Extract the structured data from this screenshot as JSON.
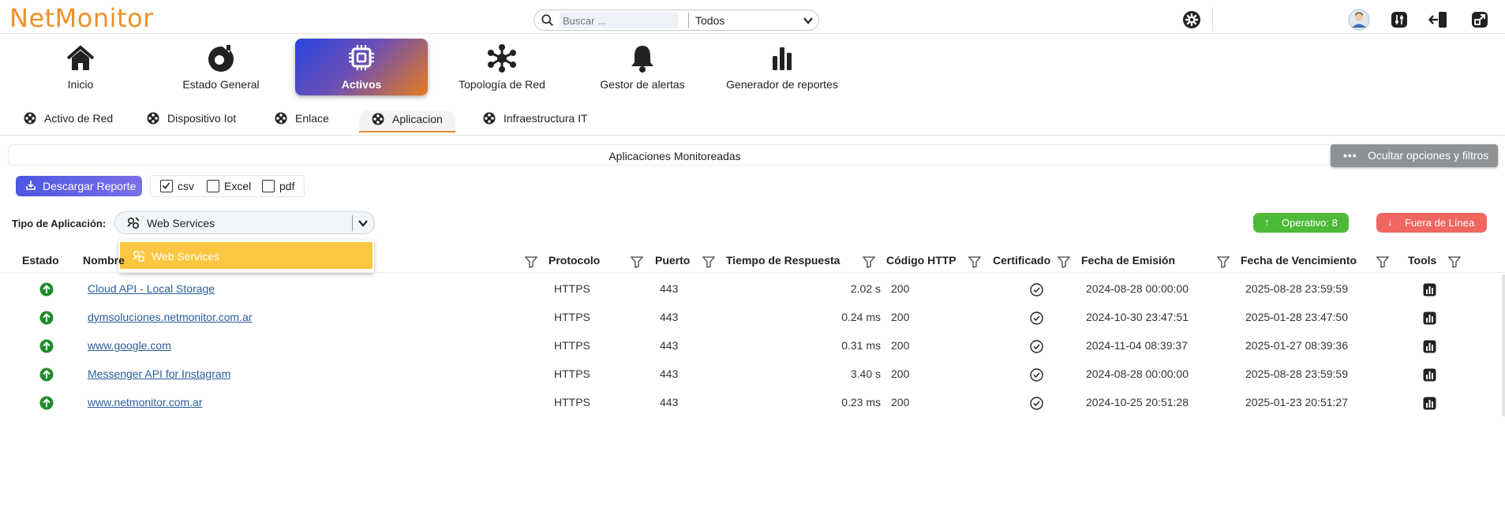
{
  "app": {
    "logo_text": "NetMonitor",
    "brand_color": "#f0902a"
  },
  "search": {
    "placeholder": "Buscar ...",
    "scope_value": "Todos"
  },
  "top_icons": [
    "gear-icon",
    "avatar",
    "sliders-icon",
    "logout-icon",
    "expand-icon"
  ],
  "main_nav": [
    {
      "label": "Inicio",
      "icon": "home-icon",
      "active": false
    },
    {
      "label": "Estado General",
      "icon": "gauge-icon",
      "active": false
    },
    {
      "label": "Activos",
      "icon": "chip-icon",
      "active": true
    },
    {
      "label": "Topología de Red",
      "icon": "network-icon",
      "active": false
    },
    {
      "label": "Gestor de alertas",
      "icon": "bell-icon",
      "active": false
    },
    {
      "label": "Generador de reportes",
      "icon": "bar-chart-icon",
      "active": false
    }
  ],
  "sub_tabs": [
    {
      "label": "Activo de Red",
      "active": false
    },
    {
      "label": "Dispositivo Iot",
      "active": false
    },
    {
      "label": "Enlace",
      "active": false
    },
    {
      "label": "Aplicacion",
      "active": true
    },
    {
      "label": "Infraestructura IT",
      "active": false
    }
  ],
  "panel": {
    "title": "Aplicaciones Monitoreadas",
    "hide_options_label": "Ocultar opciones y filtros"
  },
  "toolbar": {
    "download_label": "Descargar Reporte",
    "formats": [
      {
        "label": "csv",
        "checked": true
      },
      {
        "label": "Excel",
        "checked": false
      },
      {
        "label": "pdf",
        "checked": false
      }
    ]
  },
  "filter": {
    "app_type_label": "Tipo de Aplicación:",
    "app_type_value": "Web Services",
    "dropdown_option": "Web Services"
  },
  "status_badges": {
    "operativo": "Operativo: 8",
    "fuera": "Fuera de Línea",
    "operativo_color": "#4cba38",
    "fuera_color": "#f06660"
  },
  "table": {
    "headers": [
      "Estado",
      "Nombre",
      "Protocolo",
      "Puerto",
      "Tiempo de Respuesta",
      "Código HTTP",
      "Certificado",
      "Fecha de Emisión",
      "Fecha de Vencimiento",
      "Tools"
    ],
    "rows": [
      {
        "nombre": "Cloud API - Local Storage",
        "protocolo": "HTTPS",
        "puerto": "443",
        "tiempo": "2.02 s",
        "codigo": "200",
        "emision": "2024-08-28 00:00:00",
        "vencimiento": "2025-08-28 23:59:59"
      },
      {
        "nombre": "dymsoluciones.netmonitor.com.ar",
        "protocolo": "HTTPS",
        "puerto": "443",
        "tiempo": "0.24 ms",
        "codigo": "200",
        "emision": "2024-10-30 23:47:51",
        "vencimiento": "2025-01-28 23:47:50"
      },
      {
        "nombre": "www.google.com",
        "protocolo": "HTTPS",
        "puerto": "443",
        "tiempo": "0.31 ms",
        "codigo": "200",
        "emision": "2024-11-04 08:39:37",
        "vencimiento": "2025-01-27 08:39:36"
      },
      {
        "nombre": "Messenger API for Instagram",
        "protocolo": "HTTPS",
        "puerto": "443",
        "tiempo": "3.40 s",
        "codigo": "200",
        "emision": "2024-08-28 00:00:00",
        "vencimiento": "2025-08-28 23:59:59"
      },
      {
        "nombre": "www.netmonitor.com.ar",
        "protocolo": "HTTPS",
        "puerto": "443",
        "tiempo": "0.23 ms",
        "codigo": "200",
        "emision": "2024-10-25 20:51:28",
        "vencimiento": "2025-01-23 20:51:27"
      }
    ]
  }
}
